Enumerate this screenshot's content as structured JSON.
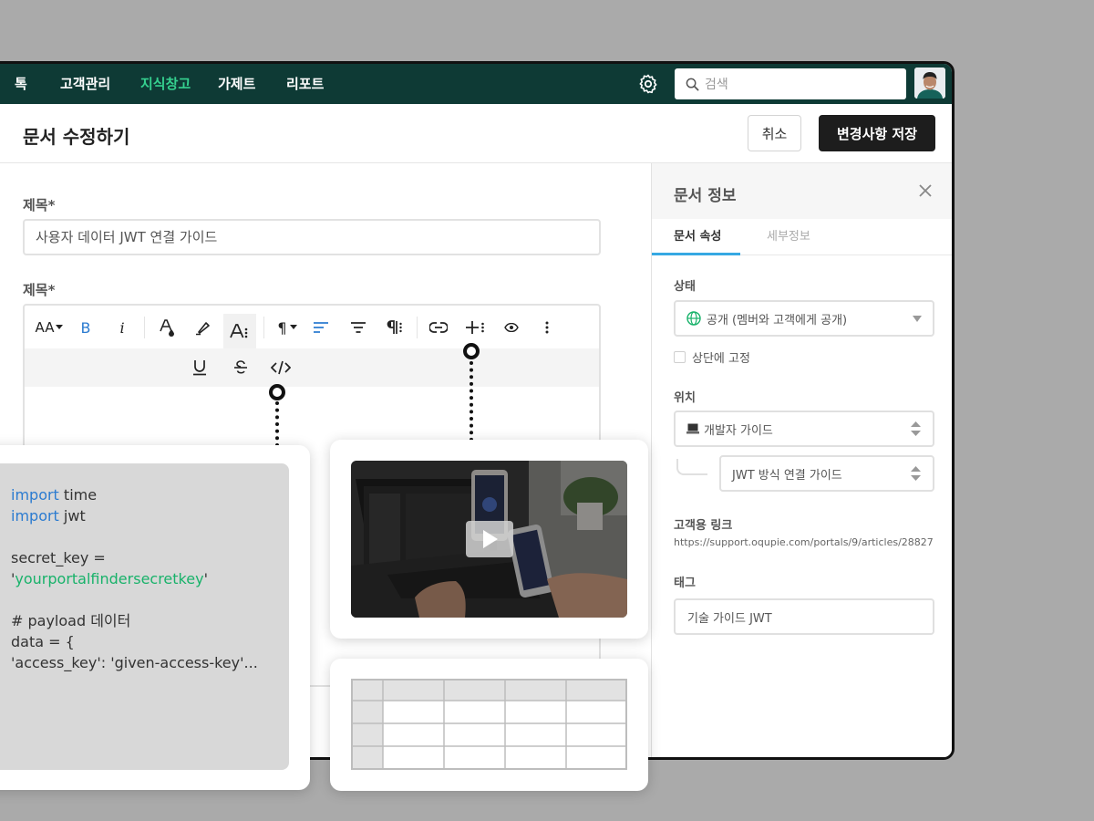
{
  "nav": {
    "items": [
      {
        "label": "톡",
        "active": false
      },
      {
        "label": "고객관리",
        "active": false
      },
      {
        "label": "지식창고",
        "active": true
      },
      {
        "label": "가제트",
        "active": false
      },
      {
        "label": "리포트",
        "active": false
      }
    ],
    "settings_icon": "gear-icon",
    "search_placeholder": "검색",
    "accent_color": "#35d08f",
    "bar_color": "#0e3a35"
  },
  "header": {
    "title": "문서 수정하기",
    "cancel_label": "취소",
    "save_label": "변경사항 저장"
  },
  "form": {
    "title_label": "제목*",
    "title_value": "사용자 데이터 JWT 연결 가이드",
    "body_label": "제목*"
  },
  "toolbar": {
    "font_size": "AA",
    "bold": "B",
    "italic": "i",
    "paragraph": "¶",
    "icons": [
      "font-size-icon",
      "bold-icon",
      "italic-icon",
      "text-color-icon",
      "highlight-icon",
      "text-style-icon",
      "paragraph-icon",
      "align-left-icon",
      "align-center-icon",
      "paragraph-format-icon",
      "link-icon",
      "insert-icon",
      "preview-icon",
      "more-icon",
      "underline-icon",
      "strikethrough-icon",
      "code-icon"
    ]
  },
  "panel": {
    "title": "문서 정보",
    "tabs": [
      {
        "label": "문서 속성",
        "active": true
      },
      {
        "label": "세부정보",
        "active": false
      }
    ],
    "status_label": "상태",
    "status_value": "공개 (멤버와 고객에게 공개)",
    "pin_label": "상단에 고정",
    "location_label": "위치",
    "location_value": "개발자 가이드",
    "sublocation_value": "JWT 방식 연결 가이드",
    "link_label": "고객용 링크",
    "link_value": "https://support.oqupie.com/portals/9/articles/28827",
    "tag_label": "태그",
    "tag_value": "기술 가이드 JWT",
    "tab_accent": "#36a8e3"
  },
  "code": {
    "lines": [
      {
        "kw": "import",
        "rest": " time"
      },
      {
        "kw": "import",
        "rest": " jwt"
      },
      {
        "plain": "secret_key ="
      },
      {
        "q1": "'",
        "str": "yourportalfindersecretkey",
        "q2": "'"
      },
      {
        "plain": "# payload 데이터"
      },
      {
        "plain": "data = {"
      },
      {
        "plain": "'access_key': 'given-access-key'..."
      }
    ],
    "keyword_color": "#2b7bd0",
    "string_color": "#18b26a"
  },
  "media": {
    "play_icon": "play-icon"
  }
}
